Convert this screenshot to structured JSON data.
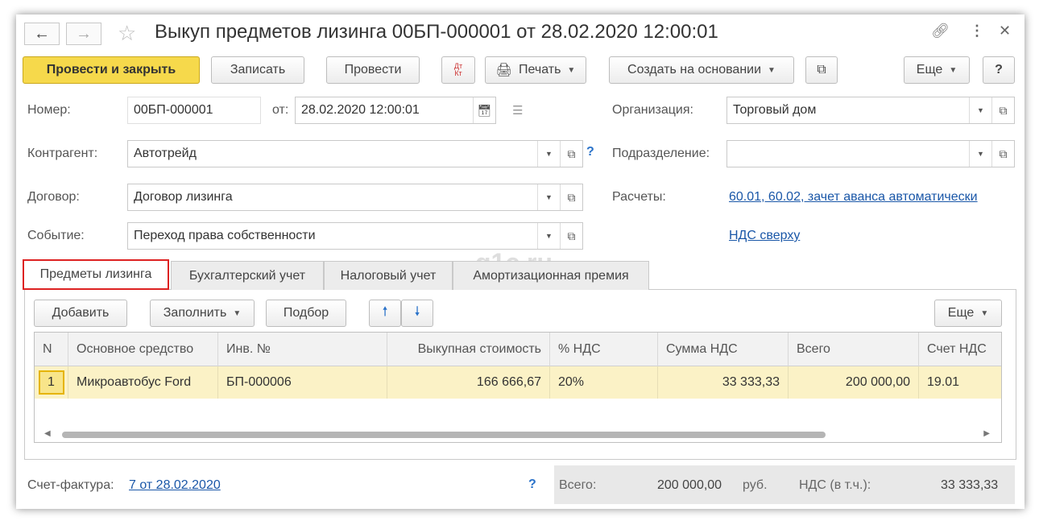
{
  "window": {
    "title": "Выкуп предметов лизинга 00БП-000001 от 28.02.2020 12:00:01"
  },
  "toolbar": {
    "post_close": "Провести и закрыть",
    "save": "Записать",
    "post": "Провести",
    "dt_kt": "Дт Кт",
    "print": "Печать",
    "create_based": "Создать на основании",
    "more": "Еще",
    "help": "?"
  },
  "form": {
    "number_label": "Номер:",
    "number_value": "00БП-000001",
    "from_label": "от:",
    "date_value": "28.02.2020 12:00:01",
    "org_label": "Организация:",
    "org_value": "Торговый дом",
    "counterparty_label": "Контрагент:",
    "counterparty_value": "Автотрейд",
    "division_label": "Подразделение:",
    "division_value": "",
    "contract_label": "Договор:",
    "contract_value": "Договор лизинга",
    "settlements_label": "Расчеты:",
    "settlements_link": "60.01, 60.02, зачет аванса автоматически",
    "event_label": "Событие:",
    "event_value": "Переход права собственности",
    "vat_link": "НДС сверху",
    "help": "?"
  },
  "tabs": [
    {
      "label": "Предметы лизинга"
    },
    {
      "label": "Бухгалтерский учет"
    },
    {
      "label": "Налоговый учет"
    },
    {
      "label": "Амортизационная премия"
    }
  ],
  "tab_toolbar": {
    "add": "Добавить",
    "fill": "Заполнить",
    "select": "Подбор",
    "more": "Еще"
  },
  "table": {
    "columns": [
      "N",
      "Основное средство",
      "Инв. №",
      "Выкупная стоимость",
      "% НДС",
      "Сумма НДС",
      "Всего",
      "Счет НДС"
    ],
    "rows": [
      [
        "1",
        "Микроавтобус Ford",
        "БП-000006",
        "166 666,67",
        "20%",
        "33 333,33",
        "200 000,00",
        "19.01"
      ]
    ]
  },
  "footer": {
    "invoice_label": "Счет-фактура:",
    "invoice_link": "7 от 28.02.2020",
    "help": "?",
    "total_label": "Всего:",
    "total_value": "200 000,00",
    "currency": "руб.",
    "vat_label": "НДС (в т.ч.):",
    "vat_value": "33 333,33"
  },
  "watermark": "q1c.ru"
}
